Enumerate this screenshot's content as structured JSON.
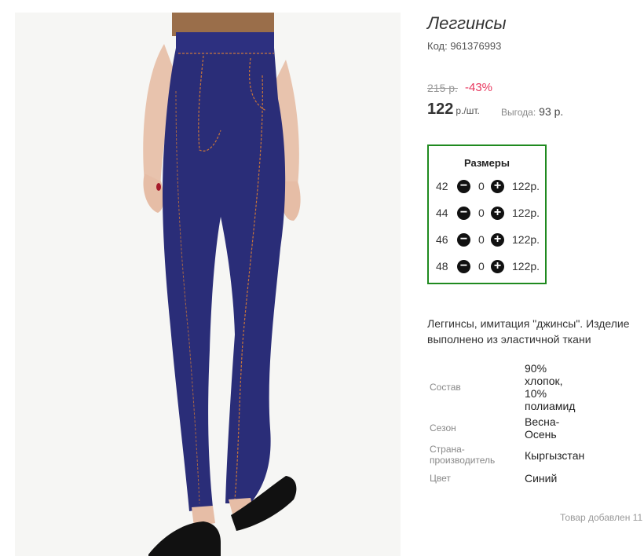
{
  "product": {
    "title": "Леггинсы",
    "code": "Код: 961376993",
    "old_price": "215 р.",
    "discount": "-43%",
    "price": "122",
    "price_unit": "р./шт.",
    "benefit_label": "Выгода:",
    "benefit_value": "93 р."
  },
  "sizes": {
    "title": "Размеры",
    "rows": [
      {
        "size": "42",
        "qty": "0",
        "price": "122р."
      },
      {
        "size": "44",
        "qty": "0",
        "price": "122р."
      },
      {
        "size": "46",
        "qty": "0",
        "price": "122р."
      },
      {
        "size": "48",
        "qty": "0",
        "price": "122р."
      }
    ],
    "minus_icon": "−",
    "plus_icon": "+"
  },
  "description": "Леггинсы, имитация \"джинсы\". Изделие выполнено из эластичной ткани",
  "properties": [
    {
      "key": "Состав",
      "value": "90% хлопок, 10% полиамид"
    },
    {
      "key": "Сезон",
      "value": "Весна-Осень"
    },
    {
      "key": "Страна-производитель",
      "value": "Кыргызстан"
    },
    {
      "key": "Цвет",
      "value": "Синий"
    }
  ],
  "added_note": "Товар добавлен 11",
  "colors": {
    "accent_border": "#1f8a1f",
    "discount": "#e8365d",
    "legging": "#2a2d78",
    "stitch": "#c8753a"
  }
}
